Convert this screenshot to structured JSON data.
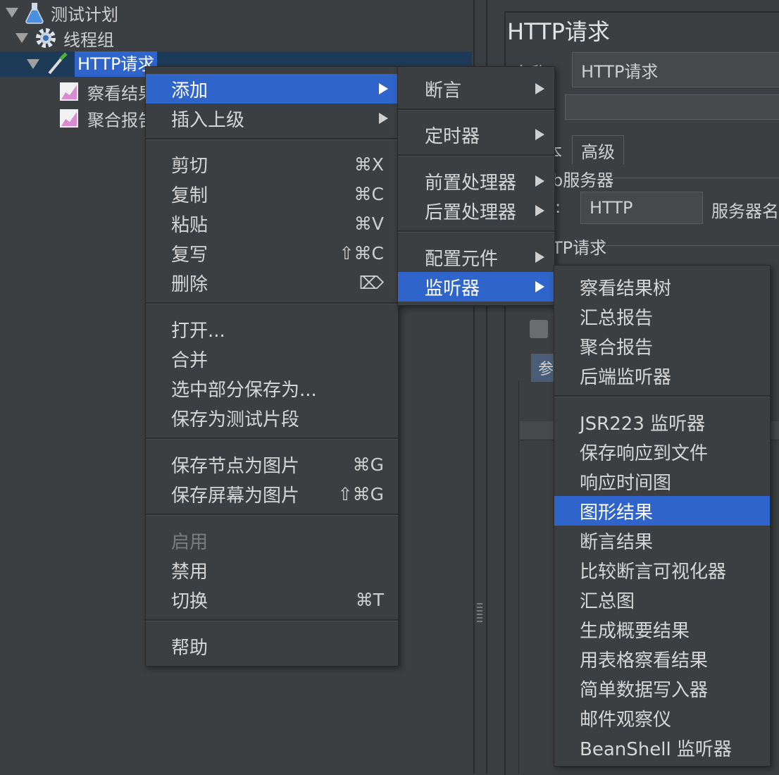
{
  "tree": {
    "items": [
      {
        "label": "测试计划",
        "icon": "flask-icon"
      },
      {
        "label": "线程组",
        "icon": "gear-icon"
      },
      {
        "label": "HTTP请求",
        "icon": "pipette-icon"
      },
      {
        "label": "察看结果",
        "icon": "chart-icon"
      },
      {
        "label": "聚合报告",
        "icon": "chart-icon"
      }
    ]
  },
  "right_panel": {
    "title": "HTTP请求",
    "name_label": "名称",
    "name_value": "HTTP请求",
    "tab_basic_fragment": "本",
    "tab_advanced": "高级",
    "web_server_fragment": "b服务器",
    "protocol_fragment": ":",
    "protocol_value": "HTTP",
    "server_label": "服务器名",
    "http_request_fragment": "TP请求",
    "params_tab_fragment": "参"
  },
  "context_menu": {
    "items": [
      {
        "label": "添加",
        "submenu": true,
        "highlighted": true
      },
      {
        "label": "插入上级",
        "submenu": true
      },
      {
        "label": "剪切",
        "shortcut": "⌘X"
      },
      {
        "label": "复制",
        "shortcut": "⌘C"
      },
      {
        "label": "粘贴",
        "shortcut": "⌘V"
      },
      {
        "label": "复写",
        "shortcut": "⇧⌘C"
      },
      {
        "label": "删除",
        "shortcut": "⌦"
      },
      {
        "label": "打开..."
      },
      {
        "label": "合并"
      },
      {
        "label": "选中部分保存为..."
      },
      {
        "label": "保存为测试片段"
      },
      {
        "label": "保存节点为图片",
        "shortcut": "⌘G"
      },
      {
        "label": "保存屏幕为图片",
        "shortcut": "⇧⌘G"
      },
      {
        "label": "启用",
        "disabled": true
      },
      {
        "label": "禁用"
      },
      {
        "label": "切换",
        "shortcut": "⌘T"
      },
      {
        "label": "帮助"
      }
    ]
  },
  "add_submenu": {
    "items": [
      {
        "label": "断言"
      },
      {
        "label": "定时器"
      },
      {
        "label": "前置处理器"
      },
      {
        "label": "后置处理器"
      },
      {
        "label": "配置元件"
      },
      {
        "label": "监听器",
        "highlighted": true
      }
    ]
  },
  "listener_submenu": {
    "items": [
      {
        "label": "察看结果树"
      },
      {
        "label": "汇总报告"
      },
      {
        "label": "聚合报告"
      },
      {
        "label": "后端监听器"
      },
      {
        "label": "JSR223 监听器"
      },
      {
        "label": "保存响应到文件"
      },
      {
        "label": "响应时间图"
      },
      {
        "label": "图形结果",
        "highlighted": true
      },
      {
        "label": "断言结果"
      },
      {
        "label": "比较断言可视化器"
      },
      {
        "label": "汇总图"
      },
      {
        "label": "生成概要结果"
      },
      {
        "label": "用表格察看结果"
      },
      {
        "label": "简单数据写入器"
      },
      {
        "label": "邮件观察仪"
      },
      {
        "label": "BeanShell 监听器"
      }
    ]
  },
  "colors": {
    "background": "#3c3f41",
    "highlight": "#2f65ca",
    "tree_selection": "#1d3a58"
  }
}
